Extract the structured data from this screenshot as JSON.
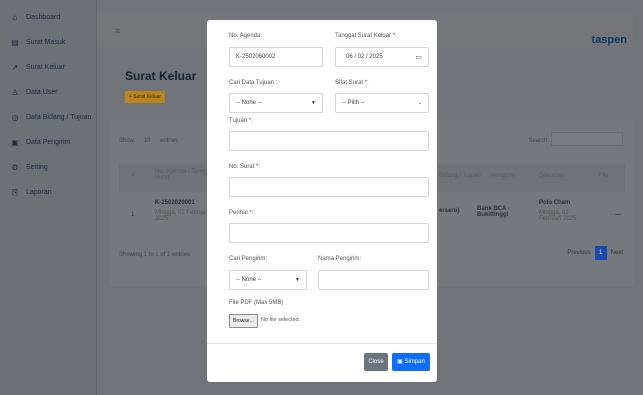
{
  "sidebar": {
    "items": [
      {
        "icon": "home-icon",
        "glyph": "⌂",
        "label": "Dashboard"
      },
      {
        "icon": "inbox-icon",
        "glyph": "▤",
        "label": "Surat Masuk"
      },
      {
        "icon": "send-icon",
        "glyph": "➚",
        "label": "Surat Keluar"
      },
      {
        "icon": "user-icon",
        "glyph": "♙",
        "label": "Data User"
      },
      {
        "icon": "building-icon",
        "glyph": "◎",
        "label": "Data Bidang / Tujuan"
      },
      {
        "icon": "id-card-icon",
        "glyph": "▣",
        "label": "Data Pengirim"
      },
      {
        "icon": "gear-icon",
        "glyph": "⚙",
        "label": "Setting"
      },
      {
        "icon": "report-icon",
        "glyph": "⎘",
        "label": "Laporan"
      }
    ]
  },
  "header": {
    "brand": "taspen",
    "brand_dot": "·"
  },
  "page": {
    "title": "Surat Keluar",
    "add_button": "+ Surat Keluar"
  },
  "table": {
    "show": "Show",
    "entries_value": "10",
    "entries": "entries",
    "search_label": "Search:",
    "headers": {
      "no": "#",
      "agenda": "No. Agenda / Tanggal Surat",
      "tujuan": "Bidang / Tujuan",
      "pengirim": "Pengirim",
      "dokumen": "Dokumen",
      "file": "File"
    },
    "row": {
      "no": "1",
      "agenda": "K-2502020001",
      "tanggal": "Minggu, 02 Februari 2025",
      "tujuan_frag": "ersero)",
      "pengirim": "Bank BCA - Bukittinggi",
      "dok": "Polo Cham",
      "dok_date": "Minggu, 02 Februari 2025",
      "file": "—"
    },
    "showing": "Showing 1 to 1 of 1 entries",
    "prev": "Previous",
    "page": "1",
    "next": "Next"
  },
  "modal": {
    "agenda_label": "No. Agenda:",
    "agenda_value": "K-2502060002",
    "tanggal_label": "Tanggal Surat Keluar *:",
    "tanggal_value": "06 / 02 / 2025",
    "cari_tujuan_label": "Cari Data Tujuan :",
    "cari_tujuan_value": "-- None --",
    "sifat_label": "Sifat Surat *:",
    "sifat_value": "-- Pilih --",
    "tujuan_label": "Tujuan *:",
    "no_surat_label": "No. Surat *:",
    "perihal_label": "Perihal *:",
    "cari_pengirim_label": "Cari Pengirim:",
    "cari_pengirim_value": "-- None --",
    "nama_pengirim_label": "Nama Pengirim:",
    "file_label": "File PDF (Max 5MB)",
    "browse": "Browse...",
    "no_file": "No file selected.",
    "close": "Close",
    "save": "Simpan",
    "save_icon": "save-icon"
  }
}
